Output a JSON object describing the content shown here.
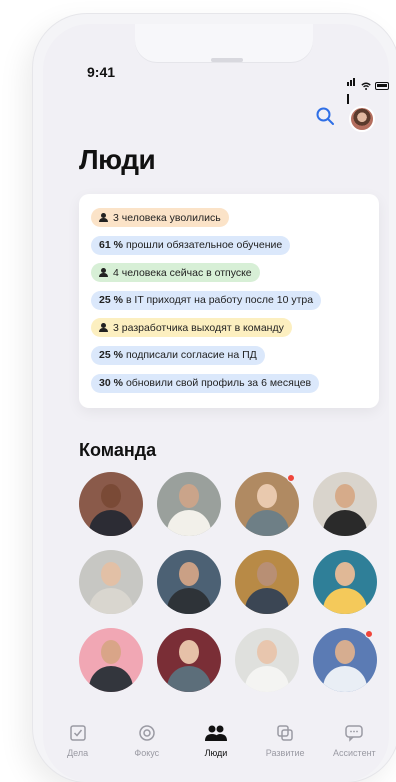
{
  "status_bar": {
    "time": "9:41"
  },
  "header": {
    "title": "Люди"
  },
  "insights": [
    {
      "icon": "person-icon",
      "bold": "",
      "text": "3 человека уволились",
      "color": "#fbe3c8"
    },
    {
      "icon": "",
      "bold": "61 %",
      "text": "прошли обязательное обучение",
      "color": "#dbe8fb"
    },
    {
      "icon": "person-icon",
      "bold": "",
      "text": "4 человека сейчас в отпуске",
      "color": "#d7efd6"
    },
    {
      "icon": "",
      "bold": "25 %",
      "text": "в IT приходят на работу после 10 утра",
      "color": "#dbe8fb"
    },
    {
      "icon": "person-icon",
      "bold": "",
      "text": "3 разработчика выходят в команду",
      "color": "#fcefc0"
    },
    {
      "icon": "",
      "bold": "25 %",
      "text": "подписали согласие на ПД",
      "color": "#dbe8fb"
    },
    {
      "icon": "",
      "bold": "30 %",
      "text": "обновили свой профиль за 6 месяцев",
      "color": "#dbe8fb"
    }
  ],
  "team": {
    "title": "Команда",
    "members": [
      {
        "bg": "#8a5a4a",
        "skin": "#7a4a36",
        "cloth": "#2c2c34",
        "notify": false
      },
      {
        "bg": "#9aa09c",
        "skin": "#caa48a",
        "cloth": "#f2f0ea",
        "notify": false
      },
      {
        "bg": "#b08a62",
        "skin": "#e9c9ae",
        "cloth": "#6e7f86",
        "notify": true
      },
      {
        "bg": "#d9d4cc",
        "skin": "#d6ab8a",
        "cloth": "#2a2a2a",
        "notify": false
      },
      {
        "bg": "#c7c7c3",
        "skin": "#e2c0a6",
        "cloth": "#d9d6cf",
        "notify": false
      },
      {
        "bg": "#4c6174",
        "skin": "#caa085",
        "cloth": "#2e3338",
        "notify": false
      },
      {
        "bg": "#b88a46",
        "skin": "#b88f74",
        "cloth": "#3b4654",
        "notify": false
      },
      {
        "bg": "#2f7f98",
        "skin": "#e0b896",
        "cloth": "#f4c95a",
        "notify": false
      },
      {
        "bg": "#f1a7b4",
        "skin": "#d9a588",
        "cloth": "#33363d",
        "notify": false
      },
      {
        "bg": "#7a2e36",
        "skin": "#e6c1a8",
        "cloth": "#5c6e7a",
        "notify": false
      },
      {
        "bg": "#dfe0dd",
        "skin": "#e8c6ae",
        "cloth": "#f4f4f2",
        "notify": false
      },
      {
        "bg": "#5b7bb4",
        "skin": "#d6ad90",
        "cloth": "#e9eef5",
        "notify": true
      }
    ]
  },
  "tabs": [
    {
      "label": "Дела",
      "icon": "checkbox-icon",
      "active": false
    },
    {
      "label": "Фокус",
      "icon": "focus-icon",
      "active": false
    },
    {
      "label": "Люди",
      "icon": "people-icon",
      "active": true
    },
    {
      "label": "Развитие",
      "icon": "growth-icon",
      "active": false
    },
    {
      "label": "Ассистент",
      "icon": "chat-icon",
      "active": false
    }
  ]
}
